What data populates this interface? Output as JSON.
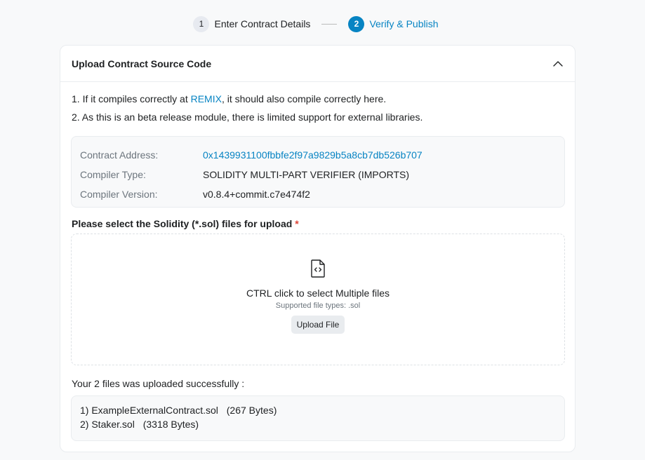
{
  "stepper": {
    "steps": [
      {
        "num": "1",
        "label": "Enter Contract Details",
        "state": "complete"
      },
      {
        "num": "2",
        "label": "Verify & Publish",
        "state": "active"
      }
    ],
    "accent_color": "#0784c3"
  },
  "card": {
    "title": "Upload Contract Source Code",
    "collapse_icon": "chevron-up-icon"
  },
  "notes": {
    "line1_prefix": "1. If it compiles correctly at ",
    "line1_link": "REMIX",
    "line1_suffix": ", it should also compile correctly here.",
    "line2": "2. As this is an beta release module, there is limited support for external libraries."
  },
  "contract_info": {
    "rows": [
      {
        "key": "Contract Address:",
        "value": "0x1439931100fbbfe2f97a9829b5a8cb7db526b707"
      },
      {
        "key": "Compiler Type:",
        "value": "SOLIDITY MULTI-PART VERIFIER (IMPORTS)"
      },
      {
        "key": "Compiler Version:",
        "value": "v0.8.4+commit.c7e474f2"
      }
    ]
  },
  "upload": {
    "label": "Please select the Solidity (*.sol) files for upload",
    "required_mark": "*",
    "icon": "file-code-icon",
    "main_text": "CTRL click to select Multiple files",
    "sub_text": "Supported file types: .sol",
    "button_label": "Upload File"
  },
  "result": {
    "message": "Your 2 files was uploaded successfully :",
    "files": [
      {
        "index": "1)",
        "name": "ExampleExternalContract.sol",
        "size": "(267 Bytes)"
      },
      {
        "index": "2)",
        "name": "Staker.sol",
        "size": "(3318 Bytes)"
      }
    ]
  }
}
